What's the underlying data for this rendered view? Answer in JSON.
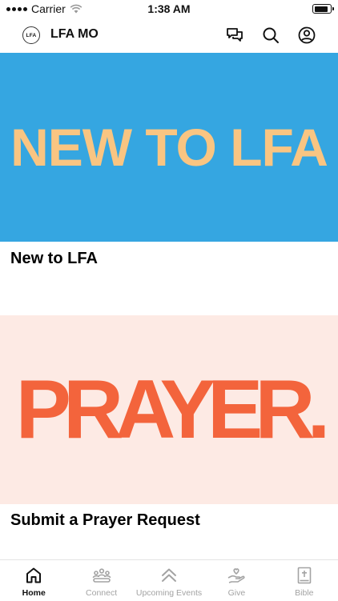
{
  "status_bar": {
    "carrier": "Carrier",
    "time": "1:38 AM",
    "battery_level": 0.9
  },
  "nav": {
    "logo_text": "LFA",
    "title": "LFA MO"
  },
  "cards": [
    {
      "image_text": "NEW TO LFA",
      "title": "New to LFA",
      "image_color": "#35a6e1",
      "text_color": "#f9c582"
    },
    {
      "image_text": "PRAYER.",
      "title": "Submit a Prayer Request",
      "image_color": "#fdeae4",
      "text_color": "#f3592e"
    }
  ],
  "tabs": [
    {
      "label": "Home",
      "icon": "home-icon",
      "active": true
    },
    {
      "label": "Connect",
      "icon": "people-icon",
      "active": false
    },
    {
      "label": "Upcoming Events",
      "icon": "chevrons-up-icon",
      "active": false
    },
    {
      "label": "Give",
      "icon": "hand-heart-icon",
      "active": false
    },
    {
      "label": "Bible",
      "icon": "bible-icon",
      "active": false
    }
  ]
}
